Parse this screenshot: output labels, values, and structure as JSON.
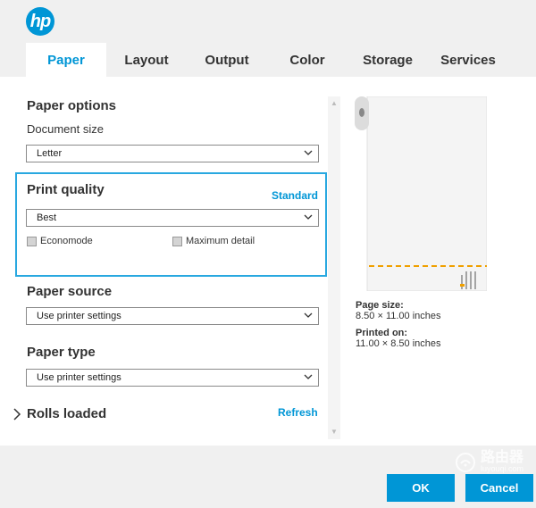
{
  "brand": {
    "logo_text": "hp",
    "accent_color": "#0096d6"
  },
  "tabs": [
    {
      "label": "Paper",
      "active": true
    },
    {
      "label": "Layout",
      "active": false
    },
    {
      "label": "Output",
      "active": false
    },
    {
      "label": "Color",
      "active": false
    },
    {
      "label": "Storage",
      "active": false
    },
    {
      "label": "Services",
      "active": false
    }
  ],
  "paper_options": {
    "title": "Paper options",
    "document_size_label": "Document size",
    "document_size_value": "Letter"
  },
  "print_quality": {
    "title": "Print quality",
    "standard_link": "Standard",
    "quality_value": "Best",
    "economode_label": "Economode",
    "maximum_detail_label": "Maximum detail"
  },
  "paper_source": {
    "title": "Paper source",
    "value": "Use printer settings"
  },
  "paper_type": {
    "title": "Paper type",
    "value": "Use printer settings"
  },
  "rolls_loaded": {
    "title": "Rolls loaded",
    "refresh_link": "Refresh"
  },
  "preview": {
    "page_size_label": "Page size:",
    "page_size_value": "8.50 × 11.00 inches",
    "printed_on_label": "Printed on:",
    "printed_on_value": "11.00 × 8.50 inches"
  },
  "footer": {
    "ok_label": "OK",
    "cancel_label": "Cancel"
  },
  "watermark": {
    "text": "路由器",
    "subtext": "luyouqi.com"
  }
}
